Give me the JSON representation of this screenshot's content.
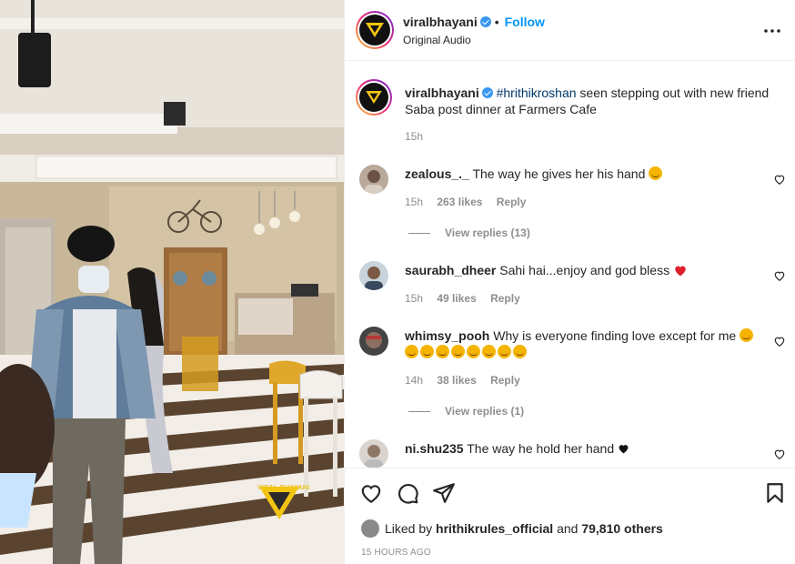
{
  "header": {
    "username": "viralbhayani",
    "follow_label": "Follow",
    "dot": "•",
    "audio_label": "Original Audio"
  },
  "watermark": {
    "text": "VIRAL BHAYANI"
  },
  "caption": {
    "username": "viralbhayani",
    "hashtag": "#hrithikroshan",
    "text": " seen stepping out with new friend Saba post dinner at Farmers Cafe",
    "time": "15h"
  },
  "comments": [
    {
      "username": "zealous_._",
      "text": "The way he gives her his hand",
      "time": "15h",
      "likes": "263 likes",
      "reply_label": "Reply",
      "view_replies": "View replies (13)"
    },
    {
      "username": "saurabh_dheer",
      "text": "Sahi hai...enjoy and god bless",
      "time": "15h",
      "likes": "49 likes",
      "reply_label": "Reply"
    },
    {
      "username": "whimsy_pooh",
      "text": "Why is everyone finding love except for me",
      "time": "14h",
      "likes": "38 likes",
      "reply_label": "Reply",
      "view_replies": "View replies (1)"
    },
    {
      "username": "ni.shu235",
      "text": "The way he hold her hand"
    }
  ],
  "likes_bar": {
    "prefix": "Liked by ",
    "user": "hrithikrules_official",
    "middle": " and ",
    "count": "79,810 others"
  },
  "timestamp": "15 HOURS AGO",
  "icons": [
    "heart-icon",
    "comment-icon",
    "share-icon",
    "bookmark-icon",
    "more-options-icon",
    "verified-icon"
  ],
  "colors": {
    "link": "#0095f6",
    "verified": "#3897f0",
    "text": "#262626",
    "muted": "#8e8e8e",
    "like_red": "#ed4956"
  }
}
